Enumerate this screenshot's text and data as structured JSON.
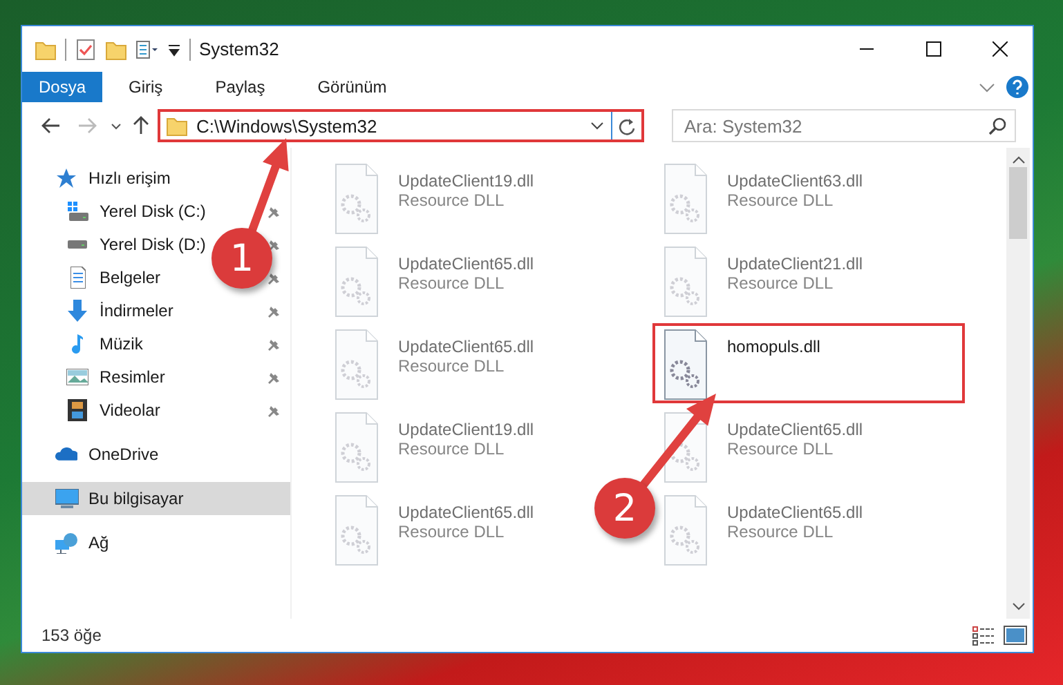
{
  "title_bar": {
    "title": "System32"
  },
  "ribbon": {
    "tabs": [
      {
        "label": "Dosya",
        "selected": true
      },
      {
        "label": "Giriş",
        "selected": false
      },
      {
        "label": "Paylaş",
        "selected": false
      },
      {
        "label": "Görünüm",
        "selected": false
      }
    ]
  },
  "address_bar": {
    "path": "C:\\Windows\\System32",
    "highlighted": true
  },
  "search": {
    "placeholder": "Ara: System32"
  },
  "navigation": [
    {
      "label": "Hızlı erişim",
      "kind": "star",
      "selected": false,
      "children": [
        {
          "label": "Yerel Disk (C:)",
          "kind": "system-drive",
          "pinned": true,
          "selected": false
        },
        {
          "label": "Yerel Disk (D:)",
          "kind": "drive",
          "pinned": true,
          "selected": false
        },
        {
          "label": "Belgeler",
          "kind": "documents",
          "pinned": true,
          "selected": false
        },
        {
          "label": "İndirmeler",
          "kind": "downloads",
          "pinned": true,
          "selected": false
        },
        {
          "label": "Müzik",
          "kind": "music",
          "pinned": true,
          "selected": false
        },
        {
          "label": "Resimler",
          "kind": "pictures",
          "pinned": true,
          "selected": false
        },
        {
          "label": "Videolar",
          "kind": "videos",
          "pinned": true,
          "selected": false
        }
      ]
    },
    {
      "label": "OneDrive",
      "kind": "cloud",
      "selected": false
    },
    {
      "label": "Bu bilgisayar",
      "kind": "computer",
      "selected": true
    },
    {
      "label": "Ağ",
      "kind": "network",
      "selected": false
    }
  ],
  "files": [
    {
      "name": "UpdateClient19.dll",
      "type": "Resource DLL",
      "blurred": true,
      "highlighted": false
    },
    {
      "name": "UpdateClient63.dll",
      "type": "Resource DLL",
      "blurred": true,
      "highlighted": false
    },
    {
      "name": "UpdateClient65.dll",
      "type": "Resource DLL",
      "blurred": true,
      "highlighted": false
    },
    {
      "name": "UpdateClient21.dll",
      "type": "Resource DLL",
      "blurred": true,
      "highlighted": false
    },
    {
      "name": "UpdateClient65.dll",
      "type": "Resource DLL",
      "blurred": true,
      "highlighted": false
    },
    {
      "name": "homopuls.dll",
      "blurred": false,
      "highlighted": true
    },
    {
      "name": "UpdateClient19.dll",
      "type": "Resource DLL",
      "blurred": true,
      "highlighted": false
    },
    {
      "name": "UpdateClient65.dll",
      "type": "Resource DLL",
      "blurred": true,
      "highlighted": false
    },
    {
      "name": "UpdateClient65.dll",
      "type": "Resource DLL",
      "blurred": true,
      "highlighted": false
    },
    {
      "name": "UpdateClient65.dll",
      "type": "Resource DLL",
      "blurred": true,
      "highlighted": false
    }
  ],
  "status_bar": {
    "item_count": "153 öğe"
  },
  "callouts": [
    {
      "label": "1"
    },
    {
      "label": "2"
    }
  ]
}
